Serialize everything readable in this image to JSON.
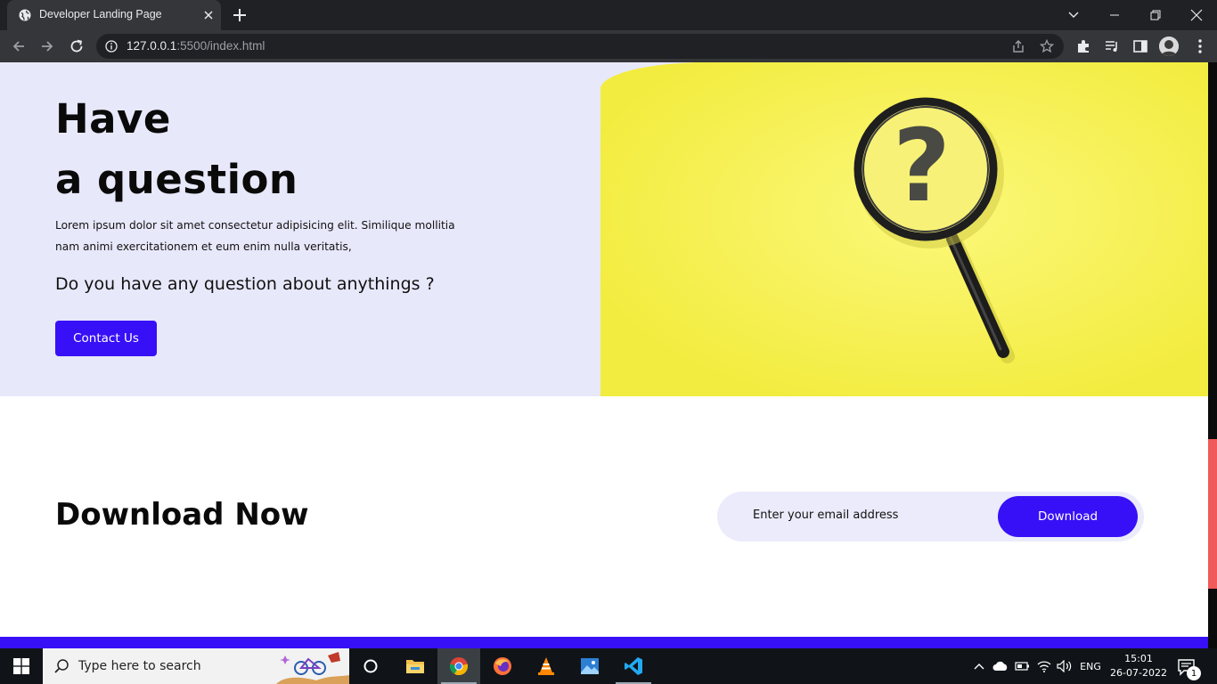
{
  "browser": {
    "tab_title": "Developer Landing Page",
    "url_host": "127.0.0.1",
    "url_rest": ":5500/index.html"
  },
  "hero": {
    "title_line1": "Have",
    "title_line2": "a question",
    "description": "Lorem ipsum dolor sit amet consectetur adipisicing elit. Similique mollitia nam animi exercitationem et eum enim nulla veritatis,",
    "subtitle": "Do you have any question about anythings ?",
    "cta_label": "Contact Us",
    "image_glyph": "?"
  },
  "download": {
    "title_bold": "Download",
    "title_light": "Now",
    "email_placeholder": "Enter your email address",
    "button_label": "Download"
  },
  "taskbar": {
    "search_placeholder": "Type here to search",
    "language": "ENG",
    "time": "15:01",
    "date": "26-07-2022",
    "notification_count": "1"
  },
  "colors": {
    "accent": "#3810f7",
    "hero_bg": "#e8e8fb",
    "hero_visual": "#f6f152",
    "scroll_thumb": "#f05a5a"
  }
}
